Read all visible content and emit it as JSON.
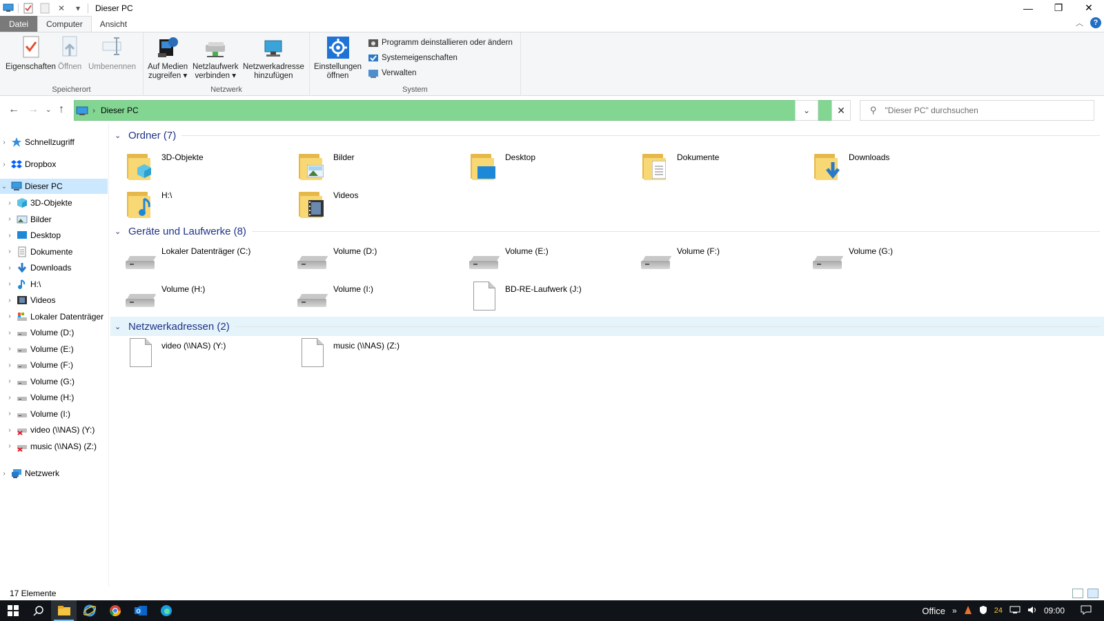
{
  "window": {
    "title": "Dieser PC",
    "controls": {
      "minimize": "—",
      "maximize": "❐",
      "close": "✕"
    }
  },
  "ribbon_tabs": [
    {
      "label": "Datei"
    },
    {
      "label": "Computer"
    },
    {
      "label": "Ansicht"
    }
  ],
  "ribbon": {
    "speicherort": {
      "label": "Speicherort",
      "buttons": [
        "Eigenschaften",
        "Öffnen",
        "Umbenennen"
      ]
    },
    "netzwerk": {
      "label": "Netzwerk",
      "auf_medien": {
        "line1": "Auf Medien",
        "line2": "zugreifen ▾"
      },
      "netzlaufwerk": {
        "line1": "Netzlaufwerk",
        "line2": "verbinden ▾"
      },
      "netzwerkadresse": {
        "line1": "Netzwerkadresse",
        "line2": "hinzufügen"
      }
    },
    "system": {
      "label": "System",
      "einstellungen": {
        "line1": "Einstellungen",
        "line2": "öffnen"
      },
      "small": [
        "Programm deinstallieren oder ändern",
        "Systemeigenschaften",
        "Verwalten"
      ]
    }
  },
  "address": {
    "crumb": "Dieser PC",
    "search_placeholder": "\"Dieser PC\" durchsuchen"
  },
  "nav": {
    "schnellzugriff": "Schnellzugriff",
    "dropbox": "Dropbox",
    "dieser_pc": "Dieser PC",
    "children": [
      "3D-Objekte",
      "Bilder",
      "Desktop",
      "Dokumente",
      "Downloads",
      "H:\\",
      "Videos",
      "Lokaler Datenträger",
      "Volume (D:)",
      "Volume (E:)",
      "Volume (F:)",
      "Volume (G:)",
      "Volume (H:)",
      "Volume (I:)",
      "video (\\\\NAS) (Y:)",
      "music (\\\\NAS) (Z:)"
    ],
    "netzwerk": "Netzwerk"
  },
  "sections": {
    "ordner": {
      "title": "Ordner (7)",
      "items": [
        "3D-Objekte",
        "Bilder",
        "Desktop",
        "Dokumente",
        "Downloads",
        "H:\\",
        "Videos"
      ]
    },
    "geraete": {
      "title": "Geräte und Laufwerke (8)",
      "items": [
        "Lokaler Datenträger (C:)",
        "Volume (D:)",
        "Volume (E:)",
        "Volume (F:)",
        "Volume (G:)",
        "Volume (H:)",
        "Volume (I:)",
        "BD-RE-Laufwerk (J:)"
      ]
    },
    "netzwerkadressen": {
      "title": "Netzwerkadressen (2)",
      "items": [
        "video (\\\\NAS) (Y:)",
        "music (\\\\NAS) (Z:)"
      ]
    }
  },
  "status": {
    "count": "17 Elemente"
  },
  "taskbar": {
    "tray_label": "Office",
    "tray_chevron": "»",
    "badge": "24",
    "time": "09:00"
  }
}
